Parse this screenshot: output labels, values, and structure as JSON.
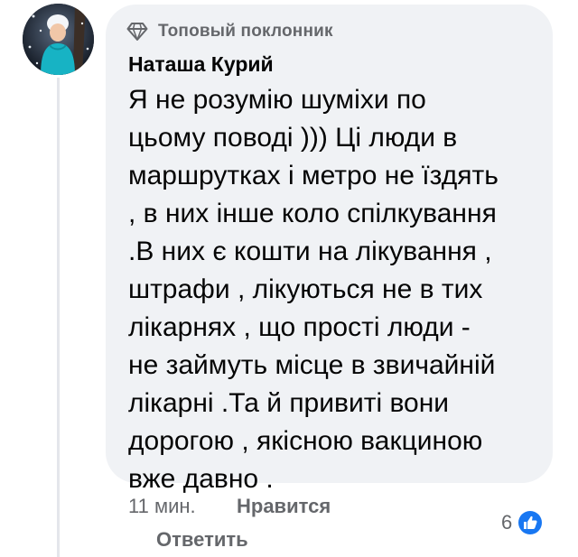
{
  "comment": {
    "badge": {
      "icon": "diamond-icon",
      "label": "Топовый поклонник"
    },
    "author": "Наташа Курий",
    "text_lines": [
      "Я не розумію шуміхи по",
      "цьому поводі ))) Ці люди в",
      "маршрутках і метро не їздять",
      ", в них інше коло спілкування",
      ".В них є кошти на лікування ,",
      "штрафи , лікуються не в тих",
      "лікарнях , що прості люди -",
      "не займуть місце в звичайній",
      "лікарні .Та й привиті вони",
      "дорогою , якісною вакциною",
      "вже давно ."
    ],
    "timestamp": "11 мин.",
    "actions": {
      "like": "Нравится",
      "reply": "Ответить"
    },
    "reactions": {
      "icon": "thumbs-up-icon",
      "count": "6"
    }
  },
  "colors": {
    "bubble": "#f0f2f5",
    "secondary_text": "#65676b",
    "like_blue": "#1877f2"
  }
}
